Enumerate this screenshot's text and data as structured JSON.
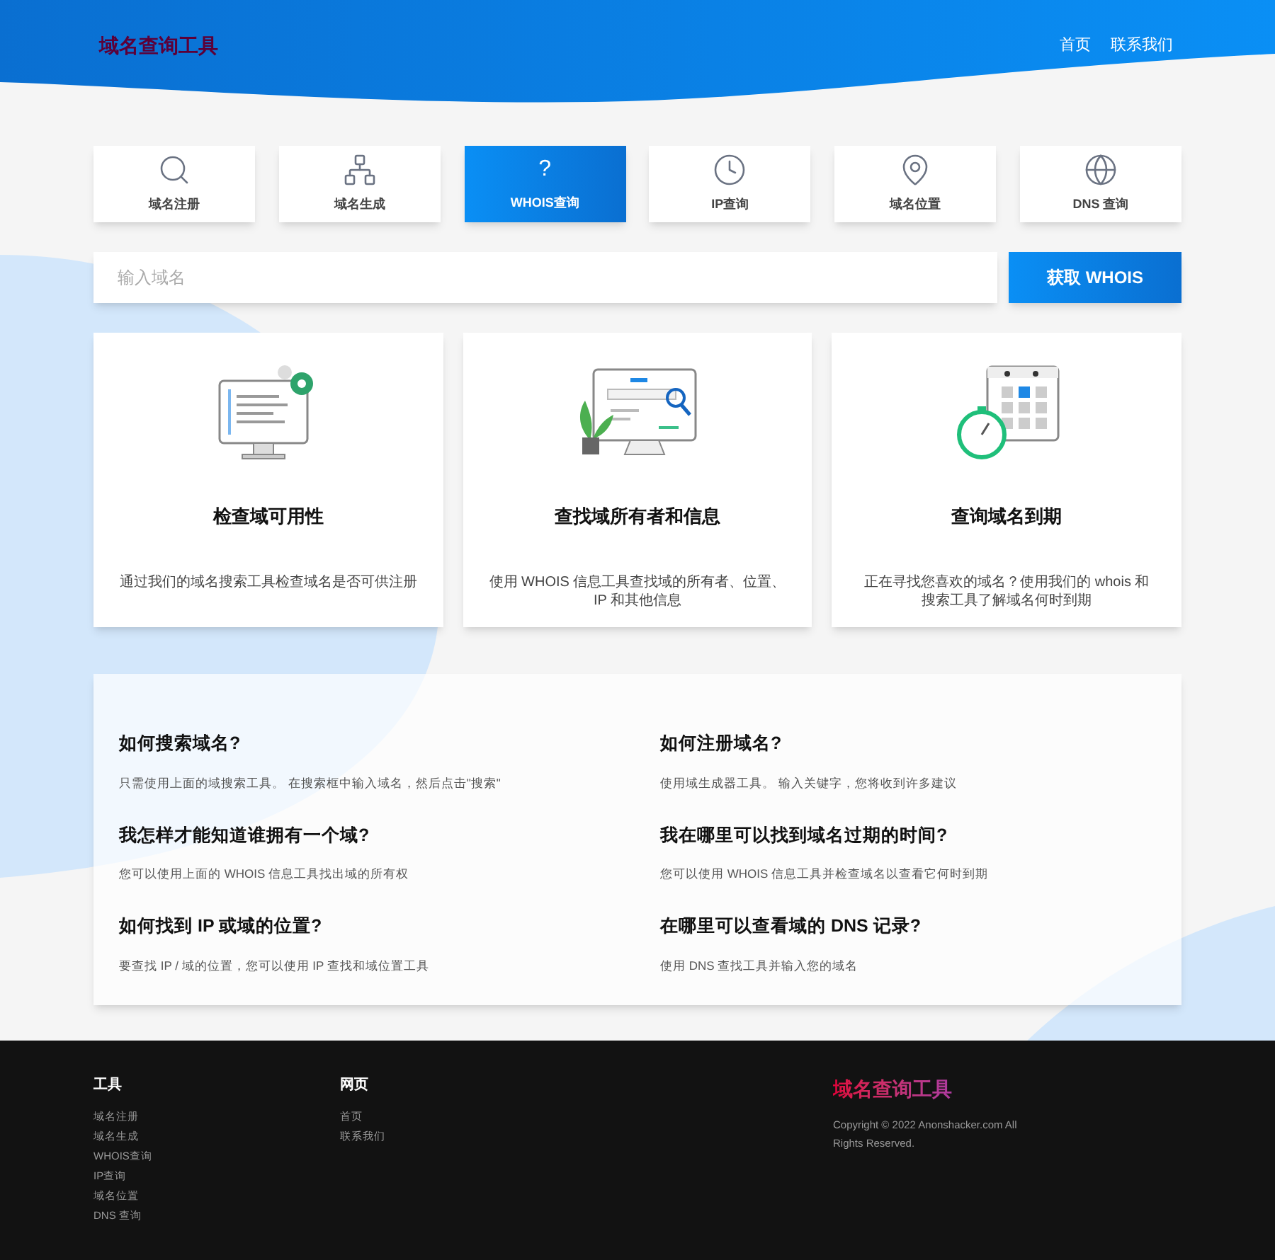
{
  "header": {
    "logo": "域名查询工具",
    "nav": [
      "首页",
      "联系我们"
    ]
  },
  "tabs": [
    {
      "label": "域名注册",
      "selected": false
    },
    {
      "label": "域名生成",
      "selected": false
    },
    {
      "label": "WHOIS查询",
      "selected": true,
      "symbol": "?"
    },
    {
      "label": "IP查询",
      "selected": false
    },
    {
      "label": "域名位置",
      "selected": false
    },
    {
      "label": "DNS 查询",
      "selected": false
    }
  ],
  "search": {
    "placeholder": "输入域名",
    "button": "获取 WHOIS"
  },
  "features": [
    {
      "title": "检查域可用性",
      "text": "通过我们的域名搜索工具检查域名是否可供注册"
    },
    {
      "title": "查找域所有者和信息",
      "text": "使用 WHOIS 信息工具查找域的所有者、位置、IP 和其他信息"
    },
    {
      "title": "查询域名到期",
      "text": "正在寻找您喜欢的域名？使用我们的 whois 和搜索工具了解域名何时到期"
    }
  ],
  "faq": [
    {
      "question": "如何搜索域名?",
      "answer": "只需使用上面的域搜索工具。 在搜索框中输入域名，然后点击\"搜索\""
    },
    {
      "question": "如何注册域名?",
      "answer": "使用域生成器工具。 输入关键字，您将收到许多建议"
    },
    {
      "question": "我怎样才能知道谁拥有一个域?",
      "answer": "您可以使用上面的 WHOIS 信息工具找出域的所有权"
    },
    {
      "question": "我在哪里可以找到域名过期的时间?",
      "answer": "您可以使用 WHOIS 信息工具并检查域名以查看它何时到期"
    },
    {
      "question": "如何找到 IP 或域的位置?",
      "answer": "要查找 IP / 域的位置，您可以使用 IP 查找和域位置工具"
    },
    {
      "question": "在哪里可以查看域的 DNS 记录?",
      "answer": "使用 DNS 查找工具并输入您的域名"
    }
  ],
  "footer": {
    "columns": [
      {
        "heading": "工具",
        "links": [
          "域名注册",
          "域名生成",
          "WHOIS查询",
          "IP查询",
          "域名位置",
          "DNS 查询"
        ]
      },
      {
        "heading": "网页",
        "links": [
          "首页",
          "联系我们"
        ]
      }
    ],
    "logo": "域名查询工具",
    "copyright": "Copyright © 2022 Anonshacker.com All Rights Reserved."
  }
}
